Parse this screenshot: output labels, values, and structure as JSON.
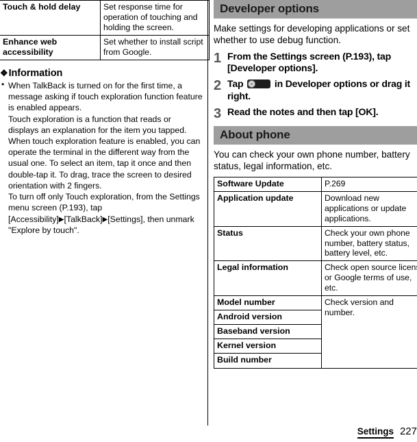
{
  "left_column": {
    "accessibility_table": {
      "rows": [
        {
          "term": "Touch & hold delay",
          "desc": "Set response time for operation of touching and holding the screen."
        },
        {
          "term": "Enhance web accessibility",
          "desc": "Set whether to install script from Google."
        }
      ]
    },
    "information": {
      "heading": "Information",
      "diamond_icon": "❖",
      "bullet_icon": "•",
      "items": [
        "When TalkBack is turned on for the first time, a message asking if touch exploration function feature is enabled appears.",
        "Touch exploration is a function that reads or displays an explanation for the item you tapped.",
        "When touch exploration feature is enabled, you can operate the terminal in the different way from the usual one. To select an item, tap it once and then double-tap it. To drag, trace the screen to desired orientation with 2 fingers."
      ],
      "final_paragraph_part1": "To turn off only Touch exploration, from the Settings menu screen (P.193), tap [Accessibility]",
      "final_paragraph_part2": "[TalkBack]",
      "final_paragraph_part3": "[Settings], then unmark \"Explore by touch\".",
      "triangle_icon": "▶"
    }
  },
  "right_column": {
    "developer_options": {
      "heading": "Developer options",
      "intro": "Make settings for developing applications or set whether to use debug function.",
      "steps": [
        {
          "num": "1",
          "text": "From the Settings screen (P.193), tap [Developer options]."
        },
        {
          "num": "2",
          "text_before": "Tap",
          "icon": "toggle-switch-icon",
          "text_after": "in Developer options or drag it right."
        },
        {
          "num": "3",
          "text": "Read the notes and then tap [OK]."
        }
      ]
    },
    "about_phone": {
      "heading": "About phone",
      "intro": "You can check your own phone number, battery status, legal information, etc.",
      "table": {
        "rows": [
          {
            "term": "Software Update",
            "desc": "P.269",
            "desc_rowspan": 1
          },
          {
            "term": "Application update",
            "desc": "Download new applications or update applications.",
            "desc_rowspan": 1
          },
          {
            "term": "Status",
            "desc": "Check your own phone number, battery status, battery level, etc.",
            "desc_rowspan": 1
          },
          {
            "term": "Legal information",
            "desc": "Check open source license or Google terms of use, etc.",
            "desc_rowspan": 1
          },
          {
            "term": "Model number",
            "desc": "Check version and number.",
            "desc_rowspan": 5
          },
          {
            "term": "Android version"
          },
          {
            "term": "Baseband version"
          },
          {
            "term": "Kernel version"
          },
          {
            "term": "Build number"
          }
        ]
      }
    }
  },
  "footer": {
    "label": "Settings",
    "page_number": "227"
  },
  "colors": {
    "section_bar": "#9e9e9e",
    "step_number": "#555555",
    "text": "#000000",
    "rule": "#000000"
  }
}
